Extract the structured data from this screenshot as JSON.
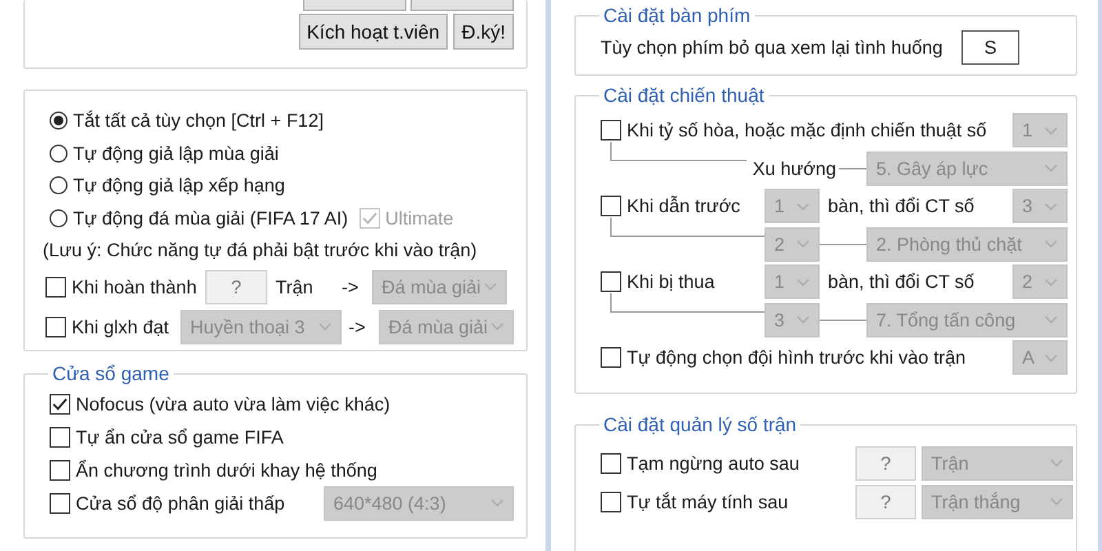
{
  "top_buttons": [
    {
      "label": "Kích hoạt t.viên"
    },
    {
      "label": "Đ.ký!"
    }
  ],
  "play_modes": [
    {
      "label": "Tắt tất cả tùy chọn [Ctrl + F12]",
      "selected": true
    },
    {
      "label": "Tự động giả lập mùa giải",
      "selected": false
    },
    {
      "label": "Tự động giả lập xếp hạng",
      "selected": false
    },
    {
      "label": "Tự động đá mùa giải (FIFA 17 AI)",
      "selected": false
    }
  ],
  "ultimate": {
    "label": "Ultimate",
    "checked": true,
    "disabled": true
  },
  "note": "(Lưu ý: Chức năng tự đá phải bật trước khi vào trận)",
  "season_rules": [
    {
      "kind": "count",
      "label": "Khi hoàn thành",
      "checked": false,
      "count": "?",
      "unit": "Trận",
      "arrow": "->",
      "action": "Đá mùa giải"
    },
    {
      "kind": "rank",
      "label": "Khi glxh đạt",
      "checked": false,
      "rank": "Huyền thoại 3",
      "arrow": "->",
      "action": "Đá mùa giải"
    }
  ],
  "game_window": {
    "title": "Cửa sổ game",
    "options": [
      {
        "label": "Nofocus (vừa auto vừa làm việc khác)",
        "checked": true
      },
      {
        "label": "Tự ẩn cửa sổ game FIFA",
        "checked": false
      },
      {
        "label": "Ẩn chương trình dưới khay hệ thống",
        "checked": false
      },
      {
        "label": "Cửa sổ độ phân giải thấp",
        "checked": false,
        "resolution": "640*480 (4:3)"
      }
    ]
  },
  "keyboard": {
    "title": "Cài đặt bàn phím",
    "label": "Tùy chọn phím bỏ qua xem lại tình huống",
    "key": "S"
  },
  "tactics": {
    "title": "Cài đặt chiến thuật",
    "rows": [
      {
        "kind": "draw",
        "label": "Khi tỷ số hòa, hoặc mặc định chiến thuật số",
        "checked": false,
        "tactic": "1",
        "trend_label": "Xu hướng",
        "trend": "5. Gây áp lực"
      },
      {
        "kind": "change",
        "label": "Khi dẫn trước",
        "checked": false,
        "goals": "1",
        "mid_label": "bàn, thì đổi CT số",
        "tactic": "3",
        "goals_2": "2",
        "style": "2. Phòng thủ chặt"
      },
      {
        "kind": "change",
        "label": "Khi bị thua",
        "checked": false,
        "goals": "1",
        "mid_label": "bàn, thì đổi CT số",
        "tactic": "2",
        "goals_2": "3",
        "style": "7. Tổng tấn công"
      },
      {
        "kind": "formation",
        "label": "Tự động chọn đội hình trước khi vào trận",
        "checked": false,
        "formation": "A"
      }
    ]
  },
  "match_management": {
    "title": "Cài đặt quản lý số trận",
    "rows": [
      {
        "label": "Tạm ngừng auto sau",
        "checked": false,
        "count": "?",
        "unit": "Trận"
      },
      {
        "label": "Tự tắt máy tính sau",
        "checked": false,
        "count": "?",
        "unit": "Trận thắng"
      }
    ]
  }
}
